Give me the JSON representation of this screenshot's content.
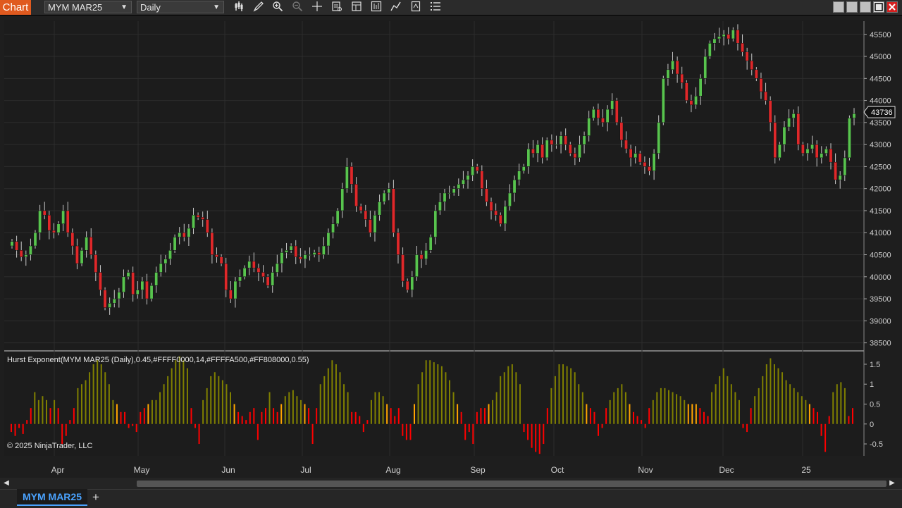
{
  "app": {
    "title_badge": "Chart",
    "instrument": "MYM MAR25",
    "timeframe": "Daily",
    "toolbar_icons": [
      "bar-type-icon",
      "draw-tool-icon",
      "zoom-in-icon",
      "zoom-out-icon",
      "crosshair-icon",
      "data-box-icon",
      "templates-icon",
      "indicators-icon",
      "strategies-icon",
      "properties-icon",
      "chart-trader-icon"
    ],
    "window_buttons": [
      "minimize-button",
      "restore-button",
      "maximize-button",
      "close-button"
    ]
  },
  "chart": {
    "last_price_label": "43736",
    "indicator_label": "Hurst Exponent(MYM MAR25 (Daily),0.45,#FFFF0000,14,#FFFFA500,#FF808000,0.55)",
    "copyright": "© 2025 NinjaTrader, LLC",
    "colors": {
      "up": "#58c44e",
      "down": "#e0282a",
      "wick": "#c8c8c8",
      "hurst_high": "#808000",
      "hurst_mid": "#ffa500",
      "hurst_low": "#ff0000",
      "grid": "#2d2d2d"
    }
  },
  "tabs": [
    {
      "label": "MYM MAR25",
      "active": true
    }
  ],
  "add_tab_label": "+",
  "chart_data": [
    {
      "type": "candlestick",
      "series": [
        {
          "name": "MYM MAR25"
        }
      ],
      "ylim": [
        38350,
        45800
      ],
      "y_ticks": [
        38500,
        39000,
        39500,
        40000,
        40500,
        41000,
        41500,
        42000,
        42500,
        43000,
        43500,
        44000,
        44500,
        45000,
        45500
      ],
      "x_months": [
        "Apr",
        "May",
        "Jun",
        "Jul",
        "Aug",
        "Sep",
        "Oct",
        "Nov",
        "Dec",
        "25"
      ],
      "closes": [
        40800,
        40600,
        40450,
        40500,
        40700,
        41000,
        41500,
        41400,
        41050,
        41000,
        41200,
        41500,
        41000,
        40700,
        40300,
        40600,
        40900,
        40500,
        40100,
        39700,
        39300,
        39400,
        39500,
        39650,
        40000,
        40100,
        39600,
        39700,
        39900,
        39500,
        39800,
        40100,
        40300,
        40400,
        40600,
        40900,
        41000,
        40900,
        41100,
        41400,
        41350,
        41300,
        41000,
        40500,
        40450,
        40300,
        39700,
        39500,
        39900,
        40000,
        40200,
        40350,
        40200,
        40100,
        40000,
        39800,
        40100,
        40300,
        40550,
        40600,
        40700,
        40450,
        40400,
        40500,
        40500,
        40550,
        40500,
        40700,
        41000,
        41200,
        41500,
        42000,
        42500,
        42100,
        41600,
        41500,
        41300,
        41000,
        41400,
        41700,
        41900,
        42000,
        41000,
        40500,
        39900,
        39700,
        40000,
        40500,
        40400,
        40600,
        40900,
        41500,
        41700,
        41900,
        41900,
        42000,
        42100,
        42200,
        42300,
        42500,
        42400,
        42000,
        41700,
        41500,
        41400,
        41200,
        41600,
        41900,
        42200,
        42400,
        42500,
        42900,
        42800,
        43000,
        42700,
        43100,
        43000,
        43000,
        43200,
        43000,
        42800,
        42700,
        43000,
        43200,
        43600,
        43800,
        43600,
        43500,
        43800,
        44000,
        43500,
        43100,
        42900,
        42700,
        42800,
        42600,
        42500,
        42400,
        42800,
        43500,
        44500,
        44700,
        44900,
        44600,
        44400,
        44000,
        43900,
        44100,
        44500,
        45000,
        45300,
        45400,
        45450,
        45500,
        45400,
        45600,
        45300,
        45100,
        44900,
        44700,
        44500,
        44200,
        44000,
        43500,
        42700,
        43000,
        43400,
        43600,
        43700,
        43000,
        42800,
        42900,
        43000,
        42700,
        42800,
        42900,
        42600,
        42200,
        42300,
        42700,
        43600,
        43700
      ],
      "opens": [
        40700,
        40800,
        40600,
        40450,
        40500,
        40700,
        41000,
        41500,
        41400,
        41050,
        41000,
        41200,
        41500,
        41000,
        40700,
        40300,
        40600,
        40900,
        40500,
        40100,
        39700,
        39300,
        39400,
        39500,
        39650,
        40000,
        40100,
        39600,
        39700,
        39900,
        39500,
        39800,
        40100,
        40300,
        40400,
        40600,
        40900,
        41000,
        40900,
        41100,
        41400,
        41350,
        41300,
        41000,
        40500,
        40450,
        40300,
        39700,
        39500,
        39900,
        40000,
        40200,
        40350,
        40200,
        40100,
        40000,
        39800,
        40100,
        40300,
        40550,
        40600,
        40700,
        40450,
        40400,
        40500,
        40500,
        40550,
        40500,
        40700,
        41000,
        41200,
        41500,
        42000,
        42500,
        42100,
        41600,
        41500,
        41300,
        41000,
        41400,
        41700,
        41900,
        42000,
        41000,
        40500,
        39900,
        39700,
        40000,
        40500,
        40400,
        40600,
        40900,
        41500,
        41700,
        41900,
        41900,
        42000,
        42100,
        42200,
        42300,
        42500,
        42400,
        42000,
        41700,
        41500,
        41400,
        41200,
        41600,
        41900,
        42200,
        42400,
        42500,
        42900,
        42800,
        43000,
        42700,
        43100,
        43000,
        43000,
        43200,
        43000,
        42800,
        42700,
        43000,
        43200,
        43600,
        43800,
        43600,
        43500,
        43800,
        44000,
        43500,
        43100,
        42900,
        42700,
        42800,
        42600,
        42500,
        42400,
        42800,
        43500,
        44500,
        44700,
        44900,
        44600,
        44400,
        44000,
        43900,
        44100,
        44500,
        45000,
        45300,
        45400,
        45450,
        45500,
        45400,
        45600,
        45300,
        45100,
        44900,
        44700,
        44500,
        44200,
        44000,
        43500,
        42700,
        43000,
        43400,
        43600,
        43700,
        43000,
        42800,
        42900,
        43000,
        42700,
        42800,
        42900,
        42600,
        42200,
        42300,
        42700,
        43600
      ]
    },
    {
      "type": "bar",
      "series": [
        {
          "name": "Hurst Exponent"
        }
      ],
      "ylim": [
        -0.8,
        1.8
      ],
      "y_ticks": [
        -0.5,
        0,
        0.5,
        1,
        1.5
      ],
      "values": [
        -0.2,
        -0.3,
        -0.1,
        -0.25,
        0.1,
        0.4,
        0.8,
        0.6,
        0.7,
        0.6,
        0.4,
        0.6,
        0.4,
        -0.5,
        -0.3,
        0.1,
        0.4,
        0.9,
        1.0,
        1.1,
        1.3,
        1.5,
        1.6,
        1.5,
        1.3,
        1.0,
        0.6,
        0.5,
        0.3,
        0.3,
        -0.1,
        -0.05,
        -0.2,
        0.3,
        0.4,
        0.5,
        0.6,
        0.6,
        0.8,
        1.0,
        1.2,
        1.4,
        1.6,
        1.7,
        1.6,
        1.4,
        0.4,
        -0.1,
        -0.5,
        0.6,
        0.9,
        1.2,
        1.3,
        1.2,
        1.1,
        1.0,
        0.8,
        0.5,
        0.3,
        0.2,
        0.1,
        0.3,
        0.4,
        -0.4,
        0.3,
        0.4,
        0.8,
        0.4,
        0.3,
        0.5,
        0.7,
        0.8,
        0.85,
        0.7,
        0.6,
        0.5,
        0.4,
        -0.5,
        0.4,
        1.0,
        1.2,
        1.4,
        1.6,
        1.5,
        1.3,
        1.0,
        0.8,
        0.3,
        0.3,
        0.2,
        -0.2,
        0.1,
        0.6,
        0.8,
        0.8,
        0.7,
        0.5,
        0.4,
        0.2,
        0.4,
        -0.3,
        -0.4,
        -0.4,
        0.5,
        1.0,
        1.3,
        1.6,
        1.6,
        1.55,
        1.5,
        1.45,
        1.3,
        1.1,
        0.8,
        0.5,
        0.3,
        -0.4,
        -0.2,
        -0.5,
        0.3,
        0.4,
        0.4,
        0.5,
        0.6,
        0.8,
        1.2,
        1.3,
        1.45,
        1.5,
        1.3,
        1.0,
        -0.2,
        -0.4,
        -0.6,
        -0.7,
        -0.75,
        -0.5,
        0.4,
        0.9,
        1.2,
        1.5,
        1.5,
        1.45,
        1.4,
        1.3,
        1.0,
        0.8,
        0.5,
        0.4,
        0.3,
        -0.3,
        -0.1,
        0.4,
        0.6,
        0.8,
        0.9,
        1.0,
        0.8,
        0.5,
        0.3,
        0.2,
        0.1,
        -0.1,
        0.4,
        0.6,
        0.8,
        0.9,
        0.9,
        0.85,
        0.8,
        0.75,
        0.7,
        0.6,
        0.5,
        0.5,
        0.5,
        0.4,
        0.3,
        0.2,
        0.8,
        1.0,
        1.2,
        1.4,
        1.2,
        1.0,
        0.8,
        0.6,
        -0.1,
        -0.2,
        0.4,
        0.7,
        0.9,
        1.2,
        1.5,
        1.65,
        1.5,
        1.4,
        1.3,
        1.1,
        1.0,
        0.9,
        0.8,
        0.7,
        0.6,
        0.5,
        0.4,
        0.3,
        -0.3,
        -0.7,
        0.2,
        0.8,
        1.0,
        1.05,
        0.9,
        0.2,
        0.4
      ]
    }
  ]
}
